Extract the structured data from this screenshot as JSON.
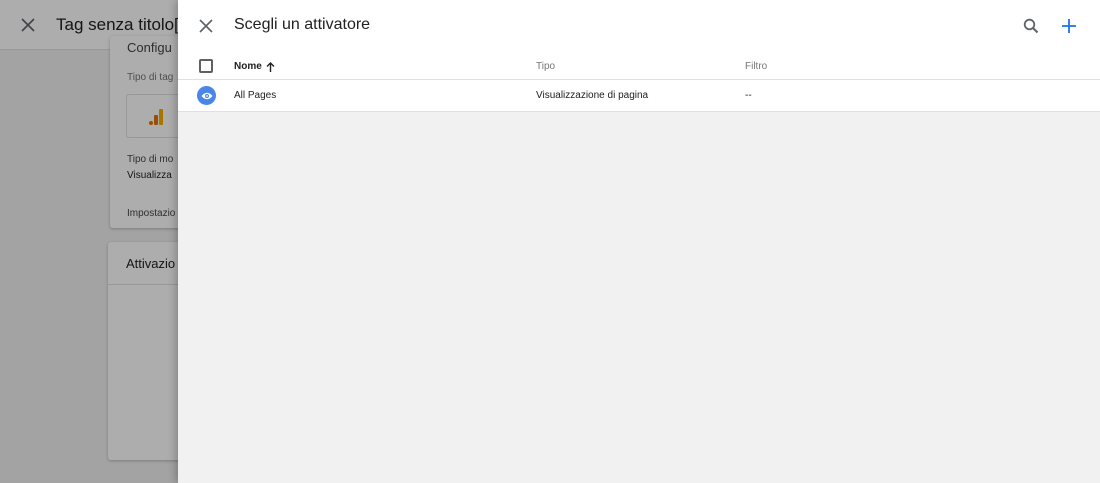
{
  "background": {
    "tag_title": "Tag senza titolo",
    "title_extra": "[",
    "card1": {
      "heading": "Configu",
      "tag_type_label": "Tipo di tag",
      "measure_type_label": "Tipo di mo",
      "measure_type_value": "Visualizza",
      "settings_label": "Impostazio"
    },
    "card2": {
      "title": "Attivazio"
    }
  },
  "panel": {
    "title": "Scegli un attivatore",
    "icons": {
      "close": "close-icon",
      "search": "search-icon",
      "add": "add-icon"
    },
    "accent_color": "#1a73e8"
  },
  "table": {
    "columns": {
      "name": "Nome",
      "type": "Tipo",
      "filter": "Filtro"
    },
    "sort": "name-ascending",
    "rows": [
      {
        "icon": "eye-icon",
        "icon_color": "#4a86e8",
        "name": "All Pages",
        "type": "Visualizzazione di pagina",
        "filter": "--"
      }
    ]
  }
}
